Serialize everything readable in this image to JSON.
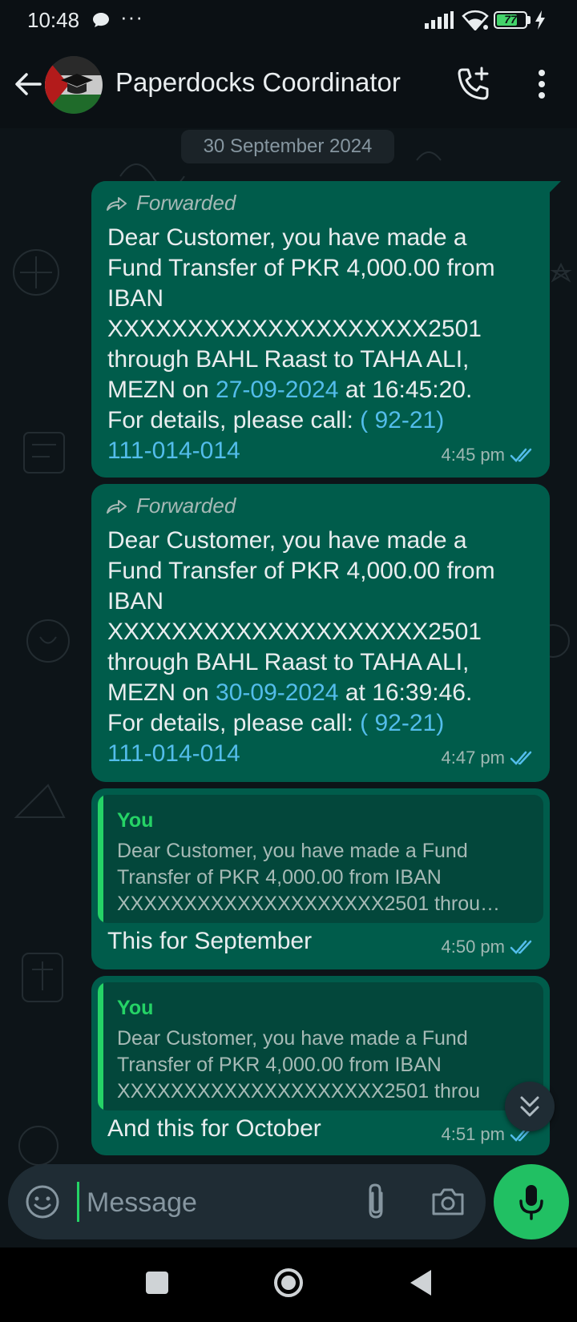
{
  "status_bar": {
    "time": "10:48",
    "dots": "···",
    "battery": "77",
    "battery_level": 0.77
  },
  "header": {
    "contact_name": "Paperdocks Coordinator",
    "icons": [
      "back-arrow-icon",
      "avatar",
      "add-call-icon",
      "more-vertical-icon"
    ]
  },
  "chat": {
    "date_chip": "30 September 2024",
    "messages": [
      {
        "forwarded_label": "Forwarded",
        "text_before_date": "Dear Customer, you have made a Fund Transfer of PKR 4,000.00 from IBAN XXXXXXXXXXXXXXXXXXXX2501 through BAHL Raast to TAHA ALI, MEZN on ",
        "date_link": "27-09-2024",
        "text_after_date": " at 16:45:20. For details, please call: ",
        "phone_link_1": "( 92-21)",
        "phone_link_2": "111-014-014",
        "time": "4:45 pm"
      },
      {
        "forwarded_label": "Forwarded",
        "text_before_date": "Dear Customer, you have made a Fund Transfer of PKR 4,000.00 from IBAN XXXXXXXXXXXXXXXXXXXX2501 through BAHL Raast to TAHA ALI, MEZN on ",
        "date_link": "30-09-2024",
        "text_after_date": " at 16:39:46. For details, please call: ",
        "phone_link_1": "( 92-21)",
        "phone_link_2": "111-014-014",
        "time": "4:47 pm"
      },
      {
        "quote_author": "You",
        "quote_line1": "Dear Customer, you have made a Fund",
        "quote_line2": "Transfer of PKR 4,000.00 from IBAN",
        "quote_line3": "XXXXXXXXXXXXXXXXXXXX2501 throu…",
        "text": "This for September",
        "time": "4:50 pm"
      },
      {
        "quote_author": "You",
        "quote_line1": "Dear Customer, you have made a Fund",
        "quote_line2": "Transfer of PKR 4,000.00 from IBAN",
        "quote_line3": "XXXXXXXXXXXXXXXXXXXX2501 throu",
        "text": "And this for October",
        "time": "4:51 pm"
      }
    ]
  },
  "composer": {
    "placeholder": "Message",
    "icons": [
      "emoji-icon",
      "paperclip-icon",
      "camera-icon",
      "mic-icon"
    ]
  },
  "colors": {
    "outgoing_bubble": "#005c4b",
    "link": "#53bdeb",
    "accent_green": "#25d366",
    "read_ticks": "#53bdeb"
  }
}
